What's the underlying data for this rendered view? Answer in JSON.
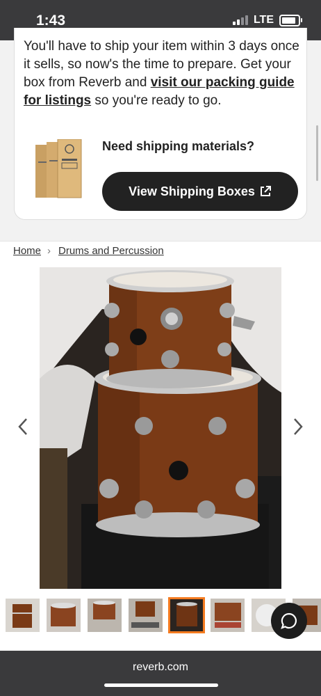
{
  "status": {
    "time": "1:43",
    "network": "LTE"
  },
  "card": {
    "text_before": "You'll have to ship your item within 3 days once it sells, so now's the time to prepare. Get your box from Reverb and ",
    "link": "visit our packing guide for listings",
    "text_after": " so you're ready to go.",
    "need_materials": "Need shipping materials?",
    "button_label": "View Shipping Boxes"
  },
  "breadcrumb": {
    "home": "Home",
    "separator": "›",
    "category": "Drums and Percussion"
  },
  "gallery": {
    "selected_thumbnail": 5,
    "thumbnail_count": 8
  },
  "browser": {
    "url": "reverb.com"
  },
  "colors": {
    "accent": "#f47b20",
    "dark": "#222222",
    "drum_wood": "#7a3a16"
  },
  "icons": {
    "prev": "chevron-left-icon",
    "next": "chevron-right-icon",
    "external": "external-link-icon",
    "chat": "chat-bubble-icon"
  }
}
